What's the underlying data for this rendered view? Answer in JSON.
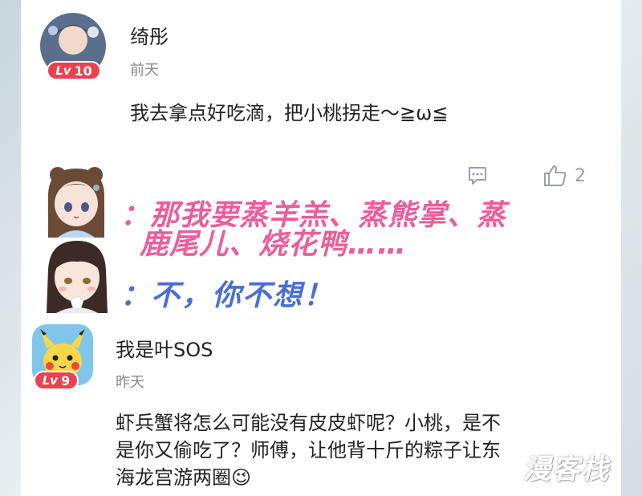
{
  "comments": [
    {
      "username": "绮彤",
      "level_prefix": "Lv",
      "level": "10",
      "time": "前天",
      "text": "我去拿点好吃滴，把小桃拐走～≧ω≦",
      "like_count": "2"
    },
    {
      "username": "我是叶SOS",
      "level_prefix": "Lv",
      "level": "9",
      "time": "昨天",
      "text_line1": "虾兵蟹将怎么可能没有皮皮虾呢？小桃，是不",
      "text_line2": "是你又偷吃了？师傅，让他背十斤的粽子让东",
      "text_line3": "海龙宫游两圈",
      "emoji": "😉"
    }
  ],
  "dialogue": {
    "line1": "：那我要蒸羊羔、蒸熊掌、蒸",
    "line2": "鹿尾儿、烧花鸭……",
    "line3": "：不，你不想！"
  },
  "watermark": "漫客栈",
  "icons": {
    "comment": "comment-icon",
    "like": "thumbs-up-icon"
  },
  "colors": {
    "level_badge": "#e8434f",
    "pink_text": "#ea5e9c",
    "blue_text": "#4a6ed6",
    "time_text": "#888888"
  }
}
